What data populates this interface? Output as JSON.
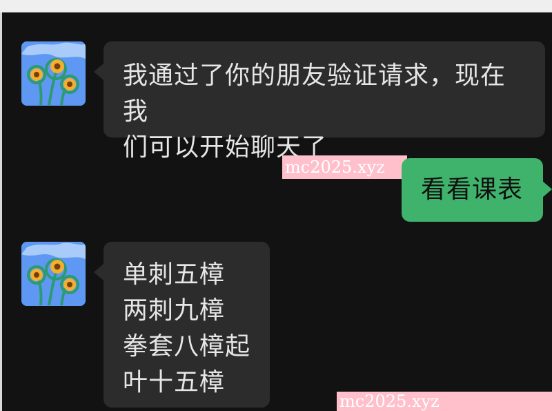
{
  "chat": {
    "messages": [
      {
        "direction": "incoming",
        "avatar": "sunflower-avatar",
        "lines": [
          "我通过了你的朋友验证请求，现在我",
          "们可以开始聊天了"
        ]
      },
      {
        "direction": "outgoing",
        "lines": [
          "看看课表"
        ]
      },
      {
        "direction": "incoming",
        "avatar": "sunflower-avatar",
        "lines": [
          "单刺五樟",
          "两刺九樟",
          "拳套八樟起",
          "叶十五樟"
        ]
      }
    ],
    "watermarks": [
      "mc2025.xyz",
      "mc2025.xyz"
    ]
  },
  "colors": {
    "background": "#121212",
    "incoming_bubble": "#2c2c2c",
    "outgoing_bubble": "#3fb36b",
    "watermark": "#ffc0cb"
  }
}
